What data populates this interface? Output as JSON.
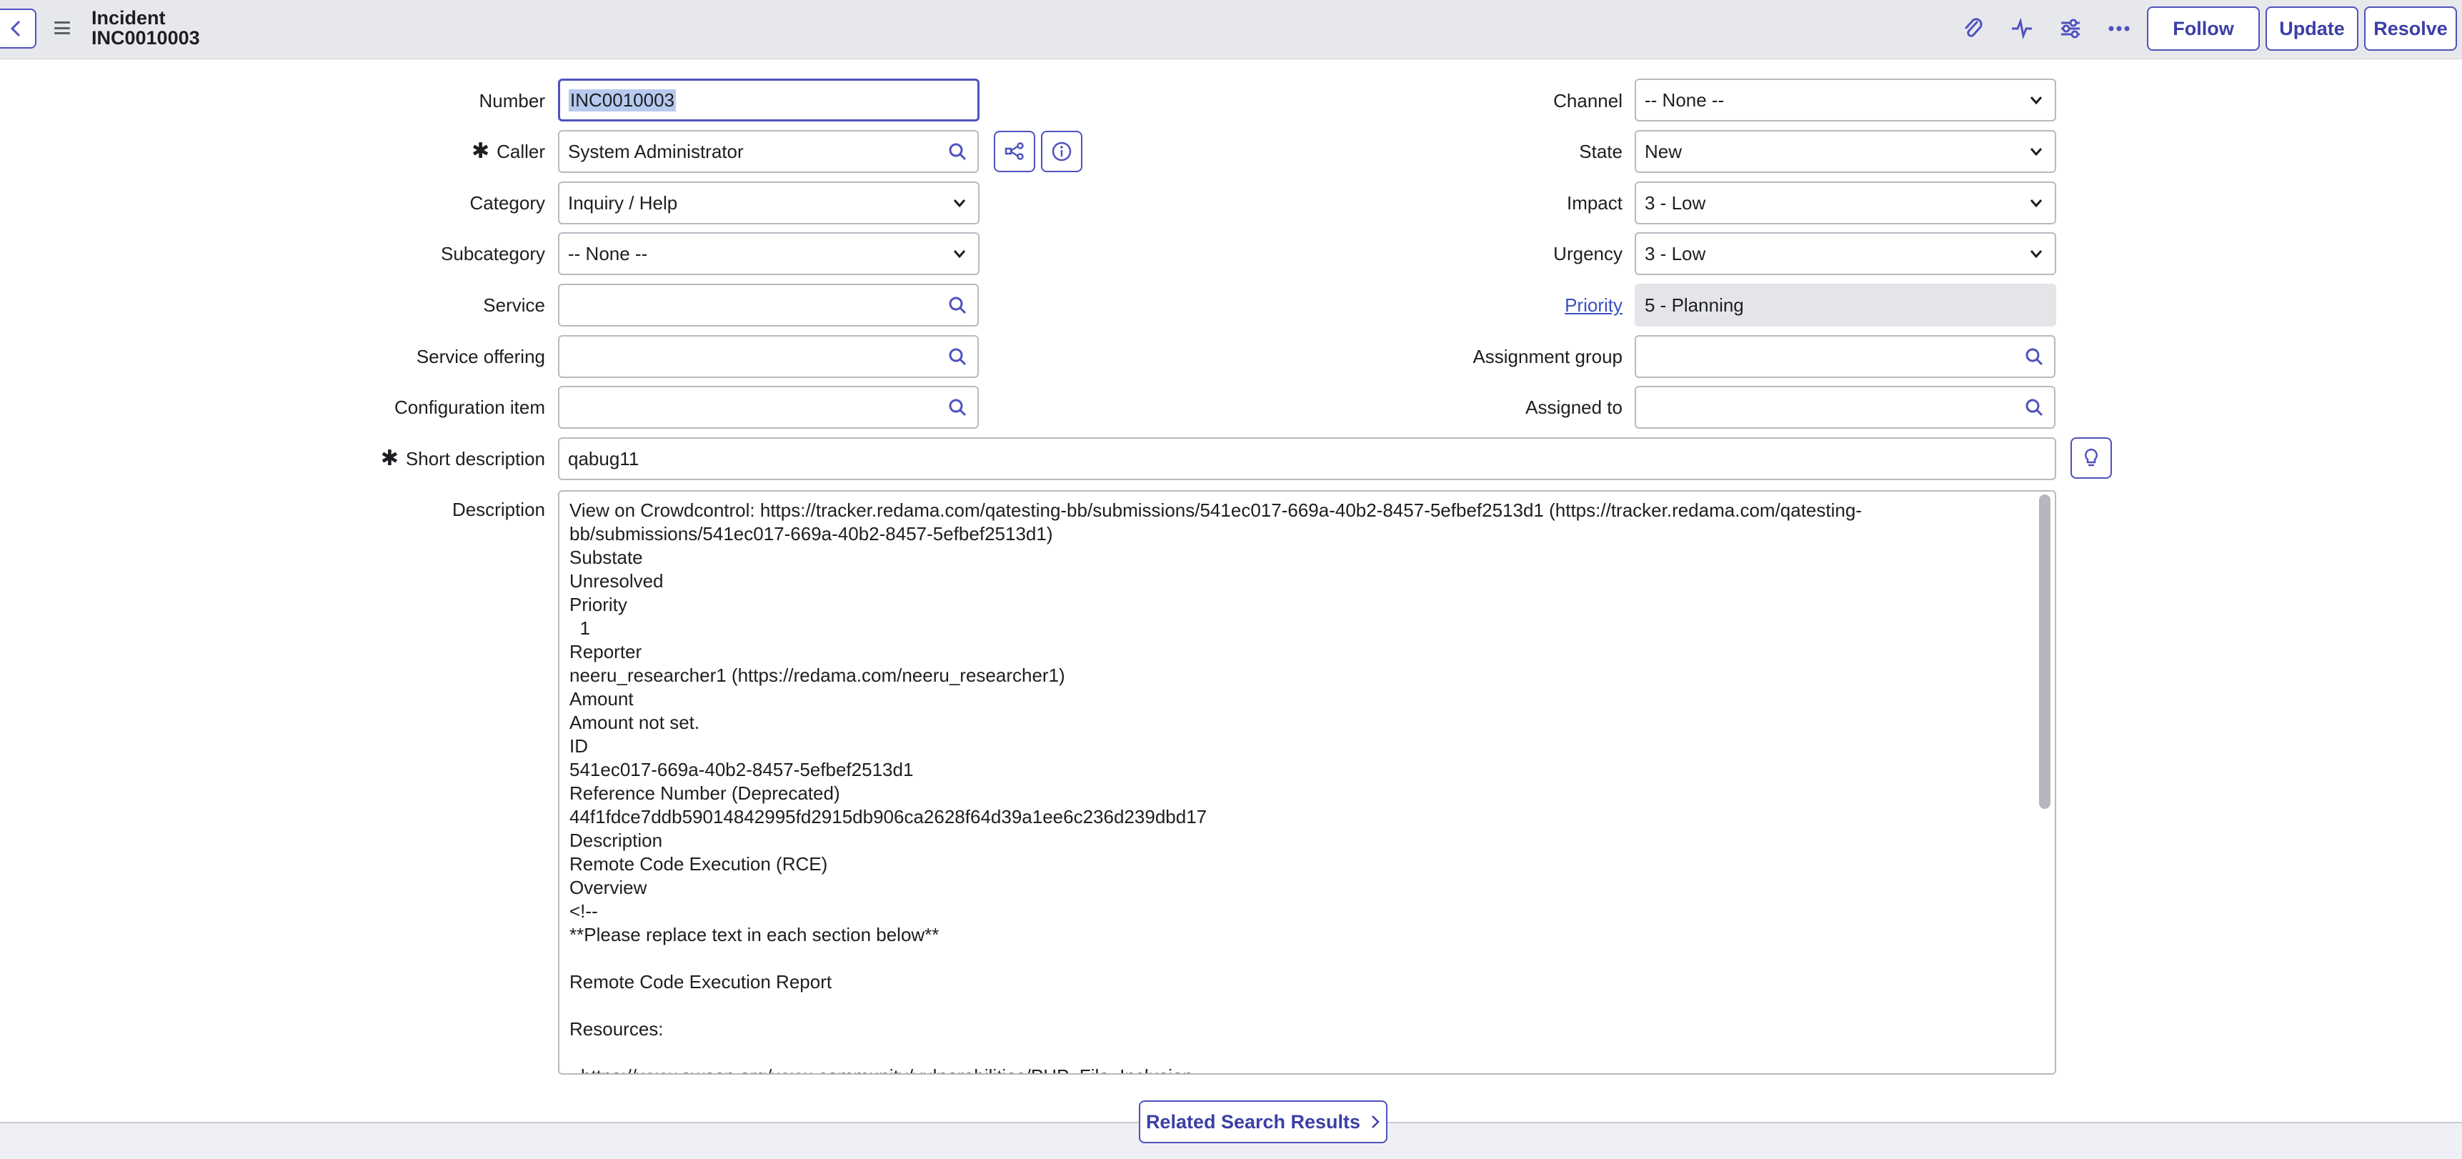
{
  "header": {
    "record_type": "Incident",
    "record_number": "INC0010003",
    "buttons": {
      "follow": "Follow",
      "update": "Update",
      "resolve": "Resolve"
    },
    "icons": [
      "back-chevron-icon",
      "hamburger-menu-icon",
      "paperclip-icon",
      "activity-pulse-icon",
      "settings-sliders-icon",
      "more-ellipsis-icon"
    ]
  },
  "form": {
    "left": {
      "number": {
        "label": "Number",
        "value": "INC0010003"
      },
      "caller": {
        "label": "Caller",
        "value": "System Administrator",
        "required_mark": "✱"
      },
      "category": {
        "label": "Category",
        "value": "Inquiry / Help"
      },
      "subcategory": {
        "label": "Subcategory",
        "value": "-- None --"
      },
      "service": {
        "label": "Service",
        "value": ""
      },
      "service_offering": {
        "label": "Service offering",
        "value": ""
      },
      "configuration_item": {
        "label": "Configuration item",
        "value": ""
      }
    },
    "right": {
      "channel": {
        "label": "Channel",
        "value": "-- None --"
      },
      "state": {
        "label": "State",
        "value": "New"
      },
      "impact": {
        "label": "Impact",
        "value": "3 - Low"
      },
      "urgency": {
        "label": "Urgency",
        "value": "3 - Low"
      },
      "priority": {
        "label": "Priority",
        "value": "5 - Planning"
      },
      "assignment_group": {
        "label": "Assignment group",
        "value": ""
      },
      "assigned_to": {
        "label": "Assigned to",
        "value": ""
      }
    },
    "short_description": {
      "label": "Short description",
      "value": "qabug11",
      "required_mark": "✱"
    },
    "description": {
      "label": "Description",
      "lines": [
        "View on Crowdcontrol: https://tracker.redama.com/qatesting-bb/submissions/541ec017-669a-40b2-8457-5efbef2513d1 (https://tracker.redama.com/qatesting-",
        "bb/submissions/541ec017-669a-40b2-8457-5efbef2513d1)",
        "Substate",
        "Unresolved",
        "Priority",
        "  1",
        "Reporter",
        "neeru_researcher1 (https://redama.com/neeru_researcher1)",
        "Amount",
        "Amount not set.",
        "ID",
        "541ec017-669a-40b2-8457-5efbef2513d1",
        "Reference Number (Deprecated)",
        "44f1fdce7ddb59014842995fd2915db906ca2628f64d39a1ee6c236d239dbd17",
        "Description",
        "Remote Code Execution (RCE)",
        "Overview",
        "<!--",
        "**Please replace text in each section below**",
        "",
        "Remote Code Execution Report",
        "",
        "Resources:",
        "",
        "- https://www.owasp.org/www-community/vulnerabilities/PHP_File_Inclusion"
      ]
    }
  },
  "footer": {
    "related_search": "Related Search Results"
  }
}
